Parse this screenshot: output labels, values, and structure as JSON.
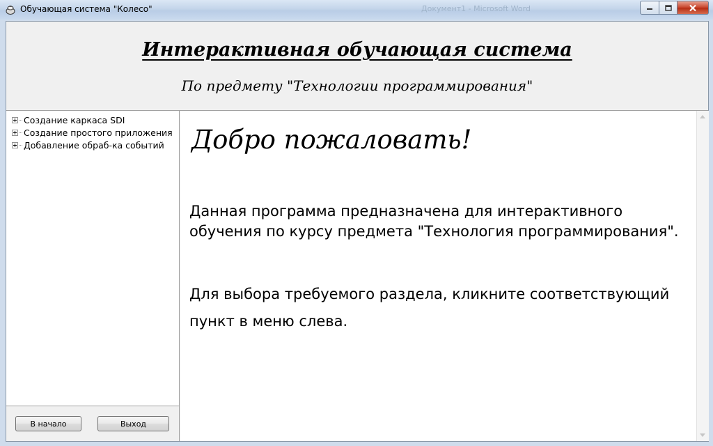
{
  "window": {
    "title": "Обучающая система \"Колесо\"",
    "background_title": "Документ1 - Microsoft Word"
  },
  "header": {
    "title": "Интерактивная обучающая система",
    "subtitle": "По предмету \"Технологии программирования\""
  },
  "tree": {
    "items": [
      {
        "label": "Создание каркаса SDI"
      },
      {
        "label": "Создание простого приложения"
      },
      {
        "label": "Добавление обраб-ка событий"
      }
    ]
  },
  "buttons": {
    "home": "В начало",
    "exit": "Выход"
  },
  "content": {
    "welcome": "Добро пожаловать!",
    "paragraph1": "Данная программа предназначена для интерактивного обучения по курсу предмета \"Технология программирования\".",
    "paragraph2": "Для выбора требуемого раздела, кликните соответствующий пункт в меню слева."
  },
  "icons": {
    "app": "teapot-icon",
    "expander": "plus-expander-icon"
  },
  "colors": {
    "titlebar": "#c4d5ea",
    "close_button": "#c7432a"
  }
}
